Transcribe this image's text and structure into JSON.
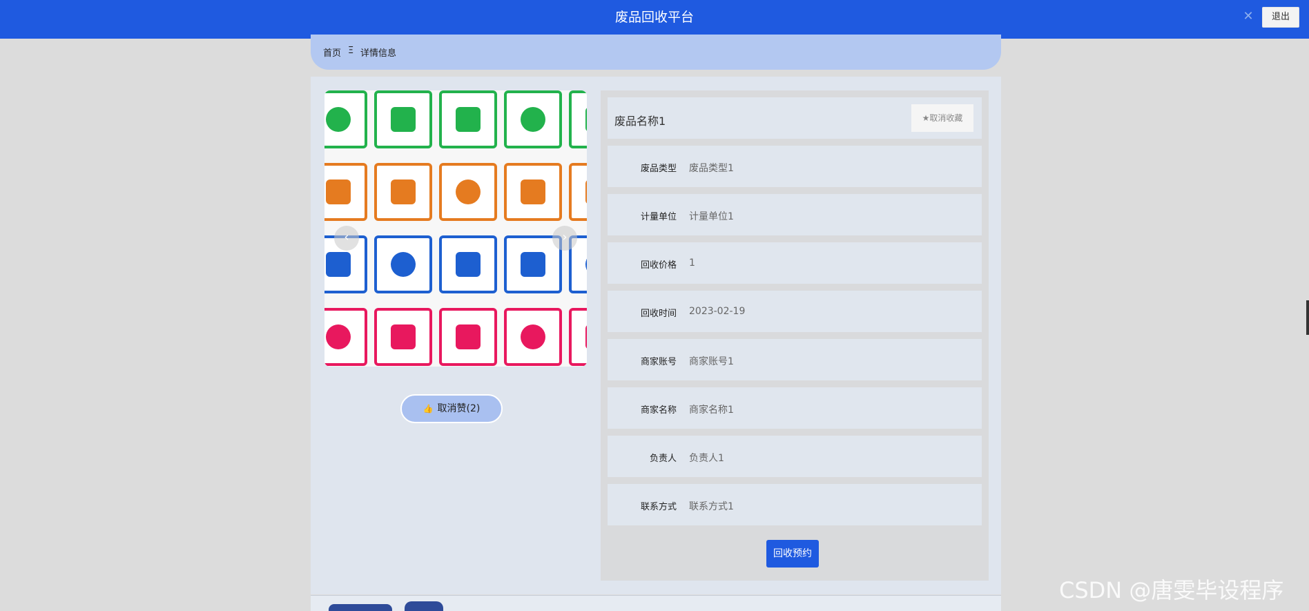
{
  "header": {
    "title": "废品回收平台",
    "close_symbol": "✕",
    "logout_label": "退出"
  },
  "breadcrumb": {
    "home": "首页",
    "separator": "Ξ",
    "current": "详情信息"
  },
  "gallery": {
    "prev_symbol": "‹",
    "next_symbol": "›",
    "like_label": "取消赞(2)",
    "thumb_symbol": "👍"
  },
  "detail": {
    "name": "废品名称1",
    "fav_label": "★取消收藏",
    "fields": [
      {
        "label": "废品类型",
        "value": "废品类型1"
      },
      {
        "label": "计量单位",
        "value": "计量单位1"
      },
      {
        "label": "回收价格",
        "value": "1"
      },
      {
        "label": "回收时间",
        "value": "2023-02-19"
      },
      {
        "label": "商家账号",
        "value": "商家账号1"
      },
      {
        "label": "商家名称",
        "value": "商家名称1"
      },
      {
        "label": "负责人",
        "value": "负责人1"
      },
      {
        "label": "联系方式",
        "value": "联系方式1"
      }
    ],
    "book_label": "回收预约"
  },
  "watermark": "CSDN @唐雯毕设程序",
  "colors": {
    "primary": "#1f5ae0",
    "green": "#22b24c",
    "orange": "#e57b20",
    "blue": "#1d5fd0",
    "pink": "#e8185e"
  }
}
